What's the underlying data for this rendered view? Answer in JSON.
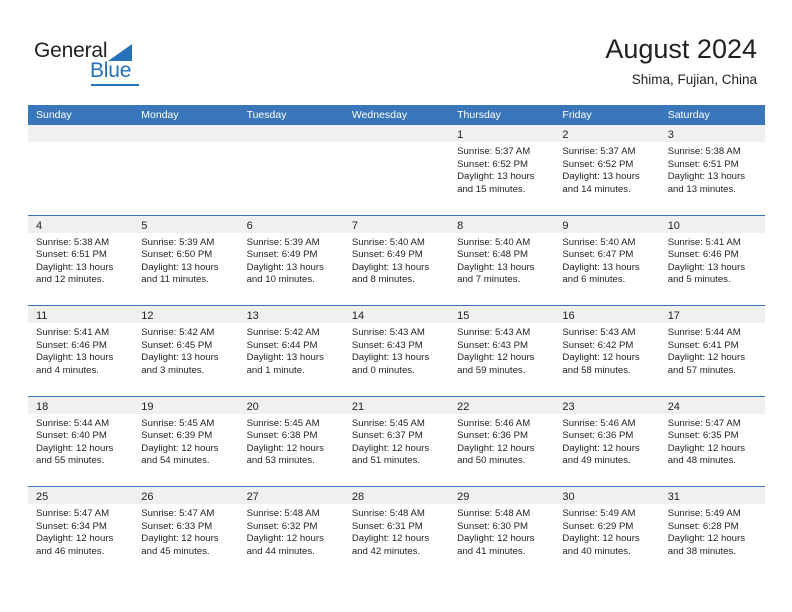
{
  "brand": {
    "name_part1": "General",
    "name_part2": "Blue",
    "triangle_color": "#2572b8",
    "text_color": "#231f20"
  },
  "header": {
    "month_title": "August 2024",
    "location": "Shima, Fujian, China"
  },
  "colors": {
    "header_blue": "#3a76ba",
    "row_divider_blue": "#3a76ba",
    "day_band_gray": "#f0f0f0",
    "text": "#231f20",
    "weekday_text": "#ffffff"
  },
  "weekdays": [
    "Sunday",
    "Monday",
    "Tuesday",
    "Wednesday",
    "Thursday",
    "Friday",
    "Saturday"
  ],
  "weeks": [
    [
      {
        "day": "",
        "empty": true,
        "sunrise": "",
        "sunset": "",
        "daylight_1": "",
        "daylight_2": ""
      },
      {
        "day": "",
        "empty": true,
        "sunrise": "",
        "sunset": "",
        "daylight_1": "",
        "daylight_2": ""
      },
      {
        "day": "",
        "empty": true,
        "sunrise": "",
        "sunset": "",
        "daylight_1": "",
        "daylight_2": ""
      },
      {
        "day": "",
        "empty": true,
        "sunrise": "",
        "sunset": "",
        "daylight_1": "",
        "daylight_2": ""
      },
      {
        "day": "1",
        "empty": false,
        "sunrise": "Sunrise: 5:37 AM",
        "sunset": "Sunset: 6:52 PM",
        "daylight_1": "Daylight: 13 hours",
        "daylight_2": "and 15 minutes."
      },
      {
        "day": "2",
        "empty": false,
        "sunrise": "Sunrise: 5:37 AM",
        "sunset": "Sunset: 6:52 PM",
        "daylight_1": "Daylight: 13 hours",
        "daylight_2": "and 14 minutes."
      },
      {
        "day": "3",
        "empty": false,
        "sunrise": "Sunrise: 5:38 AM",
        "sunset": "Sunset: 6:51 PM",
        "daylight_1": "Daylight: 13 hours",
        "daylight_2": "and 13 minutes."
      }
    ],
    [
      {
        "day": "4",
        "empty": false,
        "sunrise": "Sunrise: 5:38 AM",
        "sunset": "Sunset: 6:51 PM",
        "daylight_1": "Daylight: 13 hours",
        "daylight_2": "and 12 minutes."
      },
      {
        "day": "5",
        "empty": false,
        "sunrise": "Sunrise: 5:39 AM",
        "sunset": "Sunset: 6:50 PM",
        "daylight_1": "Daylight: 13 hours",
        "daylight_2": "and 11 minutes."
      },
      {
        "day": "6",
        "empty": false,
        "sunrise": "Sunrise: 5:39 AM",
        "sunset": "Sunset: 6:49 PM",
        "daylight_1": "Daylight: 13 hours",
        "daylight_2": "and 10 minutes."
      },
      {
        "day": "7",
        "empty": false,
        "sunrise": "Sunrise: 5:40 AM",
        "sunset": "Sunset: 6:49 PM",
        "daylight_1": "Daylight: 13 hours",
        "daylight_2": "and 8 minutes."
      },
      {
        "day": "8",
        "empty": false,
        "sunrise": "Sunrise: 5:40 AM",
        "sunset": "Sunset: 6:48 PM",
        "daylight_1": "Daylight: 13 hours",
        "daylight_2": "and 7 minutes."
      },
      {
        "day": "9",
        "empty": false,
        "sunrise": "Sunrise: 5:40 AM",
        "sunset": "Sunset: 6:47 PM",
        "daylight_1": "Daylight: 13 hours",
        "daylight_2": "and 6 minutes."
      },
      {
        "day": "10",
        "empty": false,
        "sunrise": "Sunrise: 5:41 AM",
        "sunset": "Sunset: 6:46 PM",
        "daylight_1": "Daylight: 13 hours",
        "daylight_2": "and 5 minutes."
      }
    ],
    [
      {
        "day": "11",
        "empty": false,
        "sunrise": "Sunrise: 5:41 AM",
        "sunset": "Sunset: 6:46 PM",
        "daylight_1": "Daylight: 13 hours",
        "daylight_2": "and 4 minutes."
      },
      {
        "day": "12",
        "empty": false,
        "sunrise": "Sunrise: 5:42 AM",
        "sunset": "Sunset: 6:45 PM",
        "daylight_1": "Daylight: 13 hours",
        "daylight_2": "and 3 minutes."
      },
      {
        "day": "13",
        "empty": false,
        "sunrise": "Sunrise: 5:42 AM",
        "sunset": "Sunset: 6:44 PM",
        "daylight_1": "Daylight: 13 hours",
        "daylight_2": "and 1 minute."
      },
      {
        "day": "14",
        "empty": false,
        "sunrise": "Sunrise: 5:43 AM",
        "sunset": "Sunset: 6:43 PM",
        "daylight_1": "Daylight: 13 hours",
        "daylight_2": "and 0 minutes."
      },
      {
        "day": "15",
        "empty": false,
        "sunrise": "Sunrise: 5:43 AM",
        "sunset": "Sunset: 6:43 PM",
        "daylight_1": "Daylight: 12 hours",
        "daylight_2": "and 59 minutes."
      },
      {
        "day": "16",
        "empty": false,
        "sunrise": "Sunrise: 5:43 AM",
        "sunset": "Sunset: 6:42 PM",
        "daylight_1": "Daylight: 12 hours",
        "daylight_2": "and 58 minutes."
      },
      {
        "day": "17",
        "empty": false,
        "sunrise": "Sunrise: 5:44 AM",
        "sunset": "Sunset: 6:41 PM",
        "daylight_1": "Daylight: 12 hours",
        "daylight_2": "and 57 minutes."
      }
    ],
    [
      {
        "day": "18",
        "empty": false,
        "sunrise": "Sunrise: 5:44 AM",
        "sunset": "Sunset: 6:40 PM",
        "daylight_1": "Daylight: 12 hours",
        "daylight_2": "and 55 minutes."
      },
      {
        "day": "19",
        "empty": false,
        "sunrise": "Sunrise: 5:45 AM",
        "sunset": "Sunset: 6:39 PM",
        "daylight_1": "Daylight: 12 hours",
        "daylight_2": "and 54 minutes."
      },
      {
        "day": "20",
        "empty": false,
        "sunrise": "Sunrise: 5:45 AM",
        "sunset": "Sunset: 6:38 PM",
        "daylight_1": "Daylight: 12 hours",
        "daylight_2": "and 53 minutes."
      },
      {
        "day": "21",
        "empty": false,
        "sunrise": "Sunrise: 5:45 AM",
        "sunset": "Sunset: 6:37 PM",
        "daylight_1": "Daylight: 12 hours",
        "daylight_2": "and 51 minutes."
      },
      {
        "day": "22",
        "empty": false,
        "sunrise": "Sunrise: 5:46 AM",
        "sunset": "Sunset: 6:36 PM",
        "daylight_1": "Daylight: 12 hours",
        "daylight_2": "and 50 minutes."
      },
      {
        "day": "23",
        "empty": false,
        "sunrise": "Sunrise: 5:46 AM",
        "sunset": "Sunset: 6:36 PM",
        "daylight_1": "Daylight: 12 hours",
        "daylight_2": "and 49 minutes."
      },
      {
        "day": "24",
        "empty": false,
        "sunrise": "Sunrise: 5:47 AM",
        "sunset": "Sunset: 6:35 PM",
        "daylight_1": "Daylight: 12 hours",
        "daylight_2": "and 48 minutes."
      }
    ],
    [
      {
        "day": "25",
        "empty": false,
        "sunrise": "Sunrise: 5:47 AM",
        "sunset": "Sunset: 6:34 PM",
        "daylight_1": "Daylight: 12 hours",
        "daylight_2": "and 46 minutes."
      },
      {
        "day": "26",
        "empty": false,
        "sunrise": "Sunrise: 5:47 AM",
        "sunset": "Sunset: 6:33 PM",
        "daylight_1": "Daylight: 12 hours",
        "daylight_2": "and 45 minutes."
      },
      {
        "day": "27",
        "empty": false,
        "sunrise": "Sunrise: 5:48 AM",
        "sunset": "Sunset: 6:32 PM",
        "daylight_1": "Daylight: 12 hours",
        "daylight_2": "and 44 minutes."
      },
      {
        "day": "28",
        "empty": false,
        "sunrise": "Sunrise: 5:48 AM",
        "sunset": "Sunset: 6:31 PM",
        "daylight_1": "Daylight: 12 hours",
        "daylight_2": "and 42 minutes."
      },
      {
        "day": "29",
        "empty": false,
        "sunrise": "Sunrise: 5:48 AM",
        "sunset": "Sunset: 6:30 PM",
        "daylight_1": "Daylight: 12 hours",
        "daylight_2": "and 41 minutes."
      },
      {
        "day": "30",
        "empty": false,
        "sunrise": "Sunrise: 5:49 AM",
        "sunset": "Sunset: 6:29 PM",
        "daylight_1": "Daylight: 12 hours",
        "daylight_2": "and 40 minutes."
      },
      {
        "day": "31",
        "empty": false,
        "sunrise": "Sunrise: 5:49 AM",
        "sunset": "Sunset: 6:28 PM",
        "daylight_1": "Daylight: 12 hours",
        "daylight_2": "and 38 minutes."
      }
    ]
  ]
}
